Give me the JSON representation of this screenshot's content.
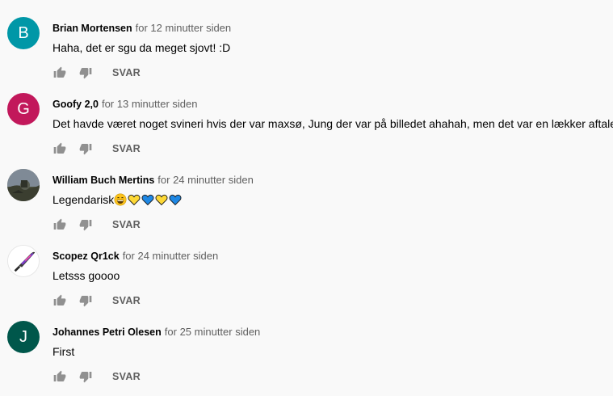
{
  "reply_label": "SVAR",
  "comments": [
    {
      "author": "Brian Mortensen",
      "time": "for 12 minutter siden",
      "text": "Haha, det er sgu da meget sjovt! :D",
      "avatar_letter": "B",
      "avatar_color": "#0097a7",
      "emojis": []
    },
    {
      "author": "Goofy 2,0",
      "time": "for 13 minutter siden",
      "text": "Det havde været noget svineri hvis der var maxsø, Jung der var på billedet ahahah, men det var en lækker aftale",
      "avatar_letter": "G",
      "avatar_color": "#c2185b",
      "emojis": []
    },
    {
      "author": "William Buch Mertins",
      "time": "for 24 minutter siden",
      "text": "Legendarisk",
      "avatar_letter": "",
      "avatar_color": "#6b6f62",
      "emojis": [
        "grinning-face",
        "yellow-heart",
        "blue-heart",
        "yellow-heart",
        "blue-heart"
      ]
    },
    {
      "author": "Scopez Qr1ck",
      "time": "for 24 minutter siden",
      "text": "Letsss goooo",
      "avatar_letter": "",
      "avatar_color": "#ffffff",
      "emojis": []
    },
    {
      "author": "Johannes Petri Olesen",
      "time": "for 25 minutter siden",
      "text": "First",
      "avatar_letter": "J",
      "avatar_color": "#00574b",
      "emojis": []
    }
  ]
}
